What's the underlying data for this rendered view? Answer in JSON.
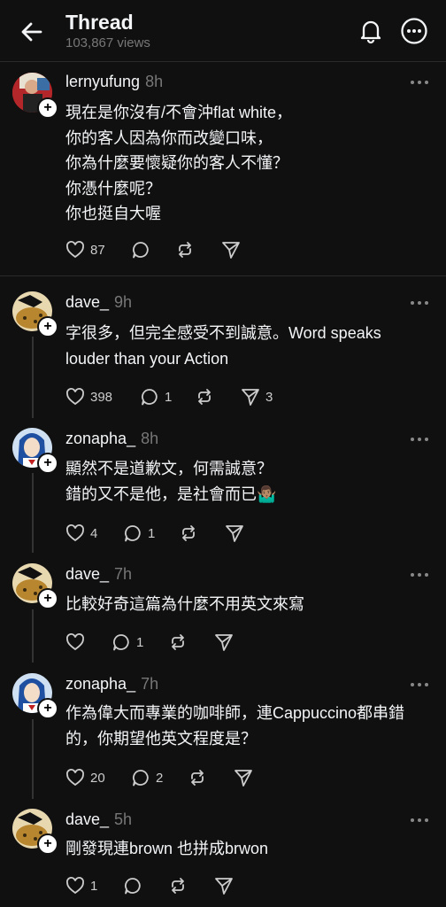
{
  "header": {
    "title": "Thread",
    "views": "103,867 views"
  },
  "posts": [
    {
      "username": "lernyufung",
      "time": "8h",
      "lines": [
        "現在是你沒有/不會沖flat white，",
        "你的客人因為你而改變口味，",
        "你為什麼要懷疑你的客人不懂？",
        "你憑什麼呢？",
        "你也挺自大喔"
      ],
      "likes": "87",
      "replies": "",
      "reposts": "",
      "shares": ""
    },
    {
      "username": "dave_",
      "time": "9h",
      "lines": [
        "字很多，但完全感受不到誠意。Word speaks",
        "louder than your Action"
      ],
      "likes": "398",
      "replies": "1",
      "reposts": "",
      "shares": "3"
    },
    {
      "username": "zonapha_",
      "time": "8h",
      "lines": [
        "顯然不是道歉文，何需誠意？",
        "錯的又不是他，是社會而已"
      ],
      "emoji": "🤷🏽‍♂️",
      "likes": "4",
      "replies": "1",
      "reposts": "",
      "shares": ""
    },
    {
      "username": "dave_",
      "time": "7h",
      "lines": [
        "比較好奇這篇為什麼不用英文來寫"
      ],
      "likes": "",
      "replies": "1",
      "reposts": "",
      "shares": ""
    },
    {
      "username": "zonapha_",
      "time": "7h",
      "lines": [
        "作為偉大而專業的咖啡師，連Cappuccino都串錯",
        "的，你期望他英文程度是？"
      ],
      "likes": "20",
      "replies": "2",
      "reposts": "",
      "shares": ""
    },
    {
      "username": "dave_",
      "time": "5h",
      "lines": [
        "剛發現連brown 也拼成brwon"
      ],
      "likes": "1",
      "replies": "",
      "reposts": "",
      "shares": ""
    }
  ]
}
